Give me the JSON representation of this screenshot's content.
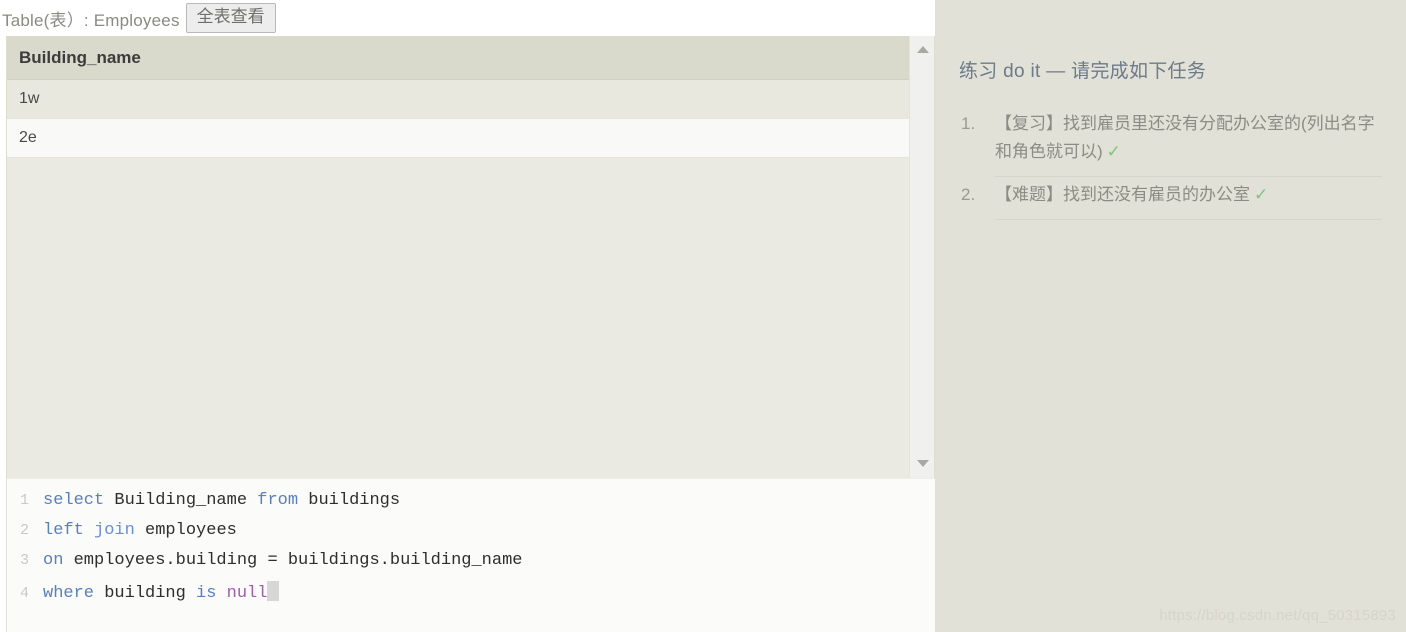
{
  "header": {
    "title": "Table(表）: Employees",
    "view_all_button": "全表查看"
  },
  "results_table": {
    "columns": [
      "Building_name"
    ],
    "rows": [
      [
        "1w"
      ],
      [
        "2e"
      ]
    ],
    "scrollbar": {
      "up_icon": "triangle-up-icon",
      "down_icon": "triangle-down-icon"
    }
  },
  "editor": {
    "lines": [
      {
        "number": "1",
        "tokens": [
          {
            "t": "select",
            "c": "kw"
          },
          {
            "t": " Building_name ",
            "c": "code-text"
          },
          {
            "t": "from",
            "c": "kw"
          },
          {
            "t": " buildings",
            "c": "code-text"
          }
        ]
      },
      {
        "number": "2",
        "tokens": [
          {
            "t": "left ",
            "c": "kw"
          },
          {
            "t": "join",
            "c": "kw2"
          },
          {
            "t": " employees",
            "c": "code-text"
          }
        ]
      },
      {
        "number": "3",
        "tokens": [
          {
            "t": "on",
            "c": "kw"
          },
          {
            "t": " employees.",
            "c": "code-text"
          },
          {
            "t": "building",
            "c": "code-text"
          },
          {
            "t": " = buildings.building_name",
            "c": "code-text"
          }
        ]
      },
      {
        "number": "4",
        "tokens": [
          {
            "t": "where",
            "c": "kw"
          },
          {
            "t": " building ",
            "c": "code-text"
          },
          {
            "t": "is",
            "c": "kw"
          },
          {
            "t": " ",
            "c": "code-text"
          },
          {
            "t": "null",
            "c": "lit"
          }
        ]
      }
    ],
    "plain_text": "select Building_name from buildings\nleft join employees\non employees.building = buildings.building_name\nwhere building is null"
  },
  "task_panel": {
    "heading": "练习 do it — 请完成如下任务",
    "items": [
      {
        "number": "1.",
        "text": "【复习】找到雇员里还没有分配办公室的(列出名字和角色就可以)",
        "status": "✓"
      },
      {
        "number": "2.",
        "text": "【难题】找到还没有雇员的办公室",
        "status": "✓"
      }
    ]
  },
  "watermark": {
    "text": "https://blog.csdn.net/qq_50315893"
  },
  "colors": {
    "panel_beige": "#e2e1d7",
    "table_bg": "#eaeae2",
    "table_header": "#d9d9cc",
    "row_odd": "#e8e8df",
    "row_even": "#f9f9f7",
    "heading": "#6c7a8a",
    "check_green": "#7fc47f",
    "keyword_blue": "#5a7fbd",
    "literal_purple": "#9b5fa8"
  }
}
